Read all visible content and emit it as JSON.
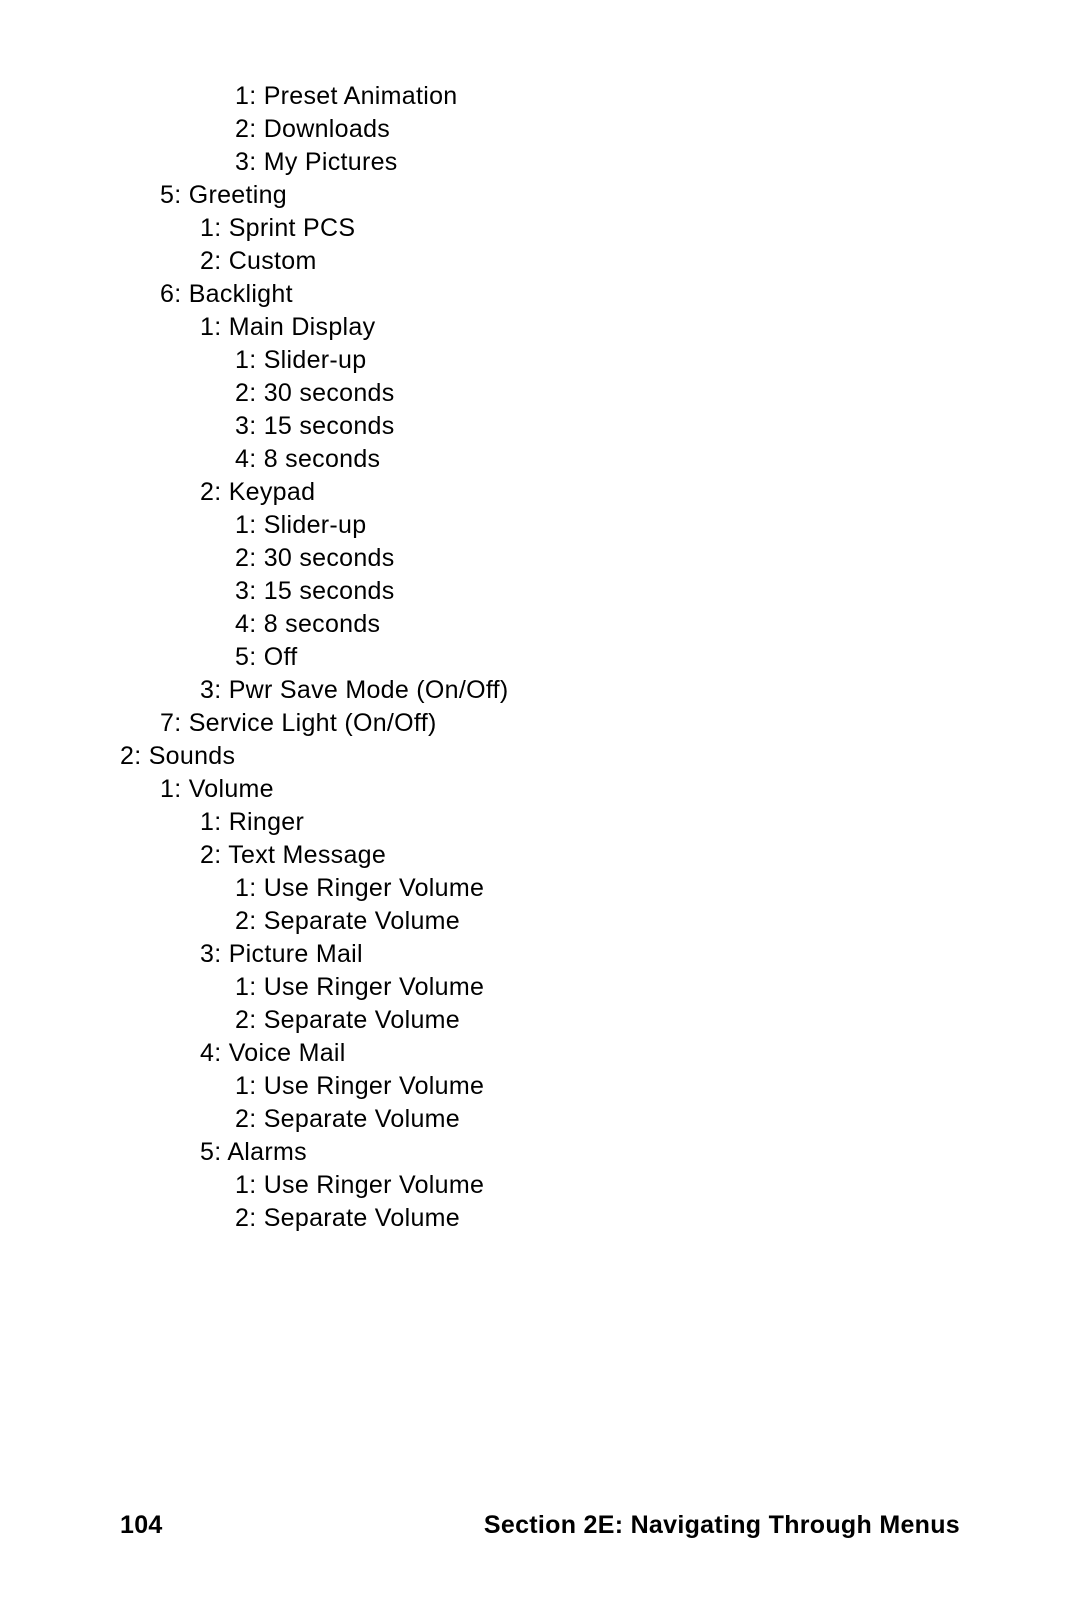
{
  "lines": [
    {
      "level": 3,
      "text": "1: Preset Animation"
    },
    {
      "level": 3,
      "text": "2: Downloads"
    },
    {
      "level": 3,
      "text": "3: My Pictures"
    },
    {
      "level": 1,
      "text": "5: Greeting"
    },
    {
      "level": 2,
      "text": "1: Sprint PCS"
    },
    {
      "level": 2,
      "text": "2: Custom"
    },
    {
      "level": 1,
      "text": "6: Backlight"
    },
    {
      "level": 2,
      "text": "1: Main Display"
    },
    {
      "level": 3,
      "text": "1: Slider-up"
    },
    {
      "level": 3,
      "text": "2: 30 seconds"
    },
    {
      "level": 3,
      "text": "3: 15 seconds"
    },
    {
      "level": 3,
      "text": "4: 8 seconds"
    },
    {
      "level": 2,
      "text": "2: Keypad"
    },
    {
      "level": 3,
      "text": "1: Slider-up"
    },
    {
      "level": 3,
      "text": "2: 30 seconds"
    },
    {
      "level": 3,
      "text": "3: 15 seconds"
    },
    {
      "level": 3,
      "text": "4: 8 seconds"
    },
    {
      "level": 3,
      "text": "5: Off"
    },
    {
      "level": 2,
      "text": "3: Pwr Save Mode (On/Off)"
    },
    {
      "level": 1,
      "text": "7: Service Light (On/Off)"
    },
    {
      "level": 0,
      "text": "2: Sounds"
    },
    {
      "level": 1,
      "text": "1: Volume"
    },
    {
      "level": 2,
      "text": "1: Ringer"
    },
    {
      "level": 2,
      "text": "2: Text Message"
    },
    {
      "level": 3,
      "text": "1: Use Ringer Volume"
    },
    {
      "level": 3,
      "text": "2: Separate Volume"
    },
    {
      "level": 2,
      "text": "3: Picture Mail"
    },
    {
      "level": 3,
      "text": "1: Use Ringer Volume"
    },
    {
      "level": 3,
      "text": "2: Separate Volume"
    },
    {
      "level": 2,
      "text": "4: Voice Mail"
    },
    {
      "level": 3,
      "text": "1: Use Ringer Volume"
    },
    {
      "level": 3,
      "text": "2: Separate Volume"
    },
    {
      "level": 2,
      "text": "5: Alarms"
    },
    {
      "level": 3,
      "text": "1: Use Ringer Volume"
    },
    {
      "level": 3,
      "text": "2: Separate Volume"
    }
  ],
  "footer": {
    "page_number": "104",
    "section": "Section 2E: Navigating Through Menus"
  }
}
